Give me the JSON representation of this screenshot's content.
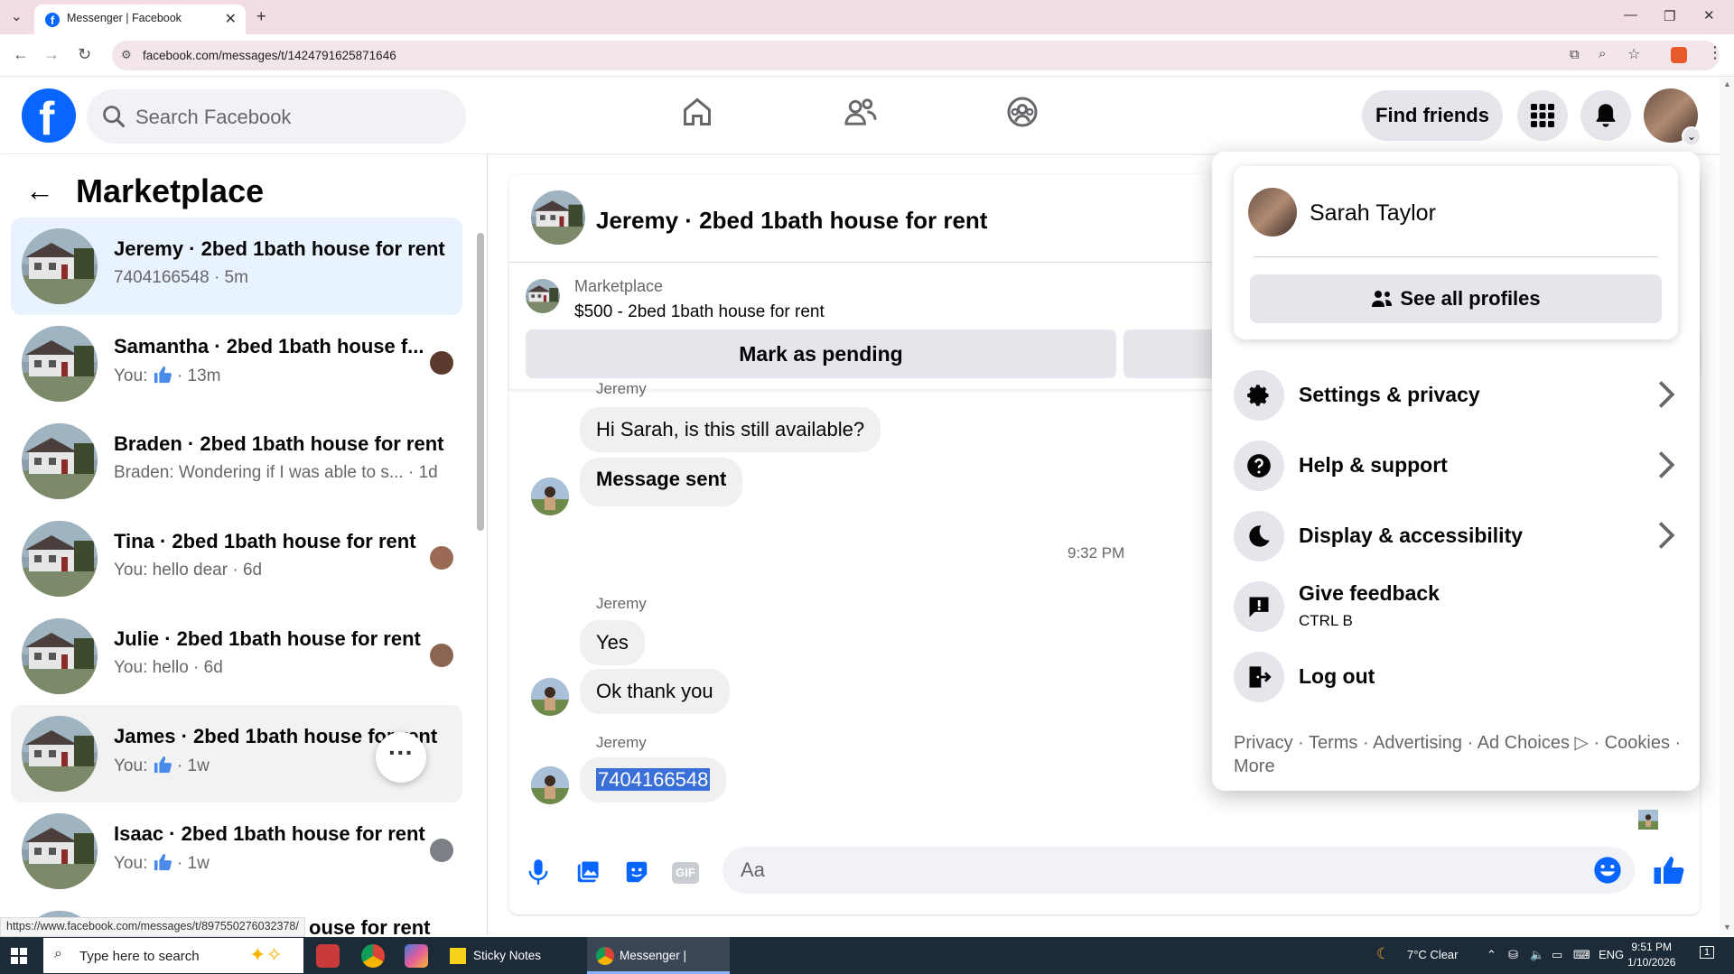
{
  "browser": {
    "tab_title": "Messenger | Facebook",
    "url": "facebook.com/messages/t/1424791625871646",
    "status_link": "https://www.facebook.com/messages/t/897550276032378/"
  },
  "header": {
    "search_placeholder": "Search Facebook",
    "find_friends": "Find friends"
  },
  "sidebar": {
    "title": "Marketplace",
    "conversations": [
      {
        "name": "Jeremy · 2bed 1bath house for rent",
        "sub": "7404166548 · 5m"
      },
      {
        "name": "Samantha · 2bed 1bath house f...",
        "sub_prefix": "You:",
        "sub_suffix": "· 13m"
      },
      {
        "name": "Braden · 2bed 1bath house for rent",
        "sub": "Braden: Wondering if I was able to s... · 1d"
      },
      {
        "name": "Tina · 2bed 1bath house for rent",
        "sub": "You: hello dear · 6d"
      },
      {
        "name": "Julie · 2bed 1bath house for rent",
        "sub": "You: hello · 6d"
      },
      {
        "name": "James · 2bed 1bath house for rent",
        "sub_prefix": "You:",
        "sub_suffix": "· 1w"
      },
      {
        "name": "Isaac · 2bed 1bath house for rent",
        "sub_prefix": "You:",
        "sub_suffix": "· 1w"
      },
      {
        "name": "ouse for rent"
      }
    ]
  },
  "chat": {
    "title": "Jeremy · 2bed 1bath house for rent",
    "listing_source": "Marketplace",
    "listing_title": "$500 - 2bed 1bath house for rent",
    "mark_pending": "Mark as pending",
    "messages": [
      {
        "sender": "Jeremy"
      },
      {
        "text": "Hi Sarah, is this still available?"
      },
      {
        "text": "Message sent"
      },
      {
        "time": "9:32 PM"
      },
      {
        "sender": "Jeremy"
      },
      {
        "text": "Yes"
      },
      {
        "text": "Ok thank you"
      },
      {
        "sender": "Jeremy"
      },
      {
        "text": "7404166548"
      }
    ],
    "input_placeholder": "Aa"
  },
  "menu": {
    "profile_name": "Sarah Taylor",
    "see_all_profiles": "See all profiles",
    "items": [
      {
        "label": "Settings & privacy"
      },
      {
        "label": "Help & support"
      },
      {
        "label": "Display & accessibility"
      },
      {
        "label": "Give feedback",
        "sub": "CTRL B"
      },
      {
        "label": "Log out"
      }
    ],
    "footer": "Privacy · Terms · Advertising · Ad Choices ▷ · Cookies · More"
  },
  "taskbar": {
    "search_placeholder": "Type here to search",
    "apps": [
      "Sticky Notes",
      "Messenger | Faceb..."
    ],
    "weather": "7°C  Clear",
    "lang": "ENG",
    "time": "9:51 PM",
    "date": "1/10/2026",
    "notif_count": "1"
  },
  "colors": {
    "fb_blue": "#0866ff",
    "selected_row": "#e8f3ff",
    "bubble": "#f0f0f0",
    "taskbar": "#1d2a38"
  }
}
